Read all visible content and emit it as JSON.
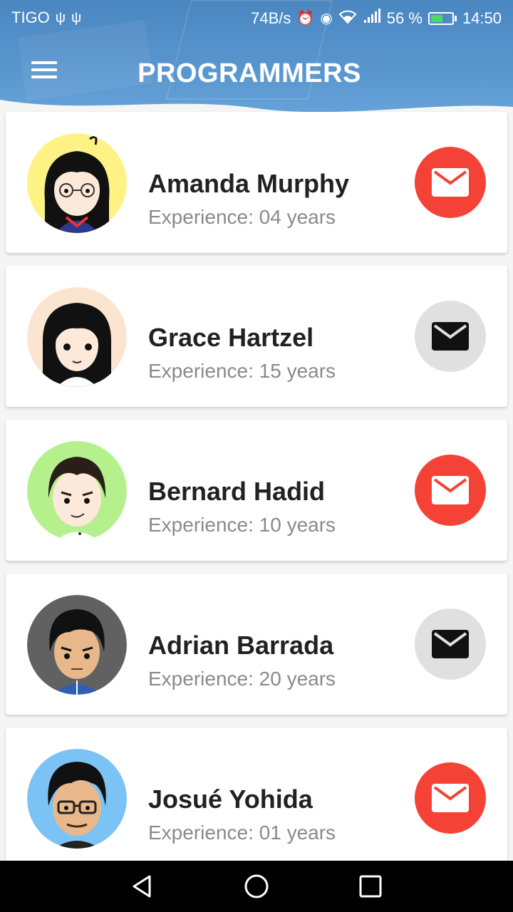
{
  "status_bar": {
    "carrier": "TIGO",
    "speed": "74B/s",
    "battery_pct": "56 %",
    "time": "14:50",
    "icons": [
      "usb-icon",
      "usb-icon",
      "alarm-icon",
      "eye-icon",
      "wifi-icon",
      "signal-icon",
      "battery-charging-icon"
    ]
  },
  "app_bar": {
    "title": "PROGRAMMERS",
    "menu_icon": "hamburger-menu-icon"
  },
  "colors": {
    "header": "#5b98d0",
    "mail_active": "#f44336",
    "mail_inactive": "#e0e0e0",
    "name_text": "#212121",
    "exp_text": "#8a8a8a"
  },
  "programmers": [
    {
      "name": "Amanda Murphy",
      "experience": "Experience: 04 years",
      "mail_state": "active",
      "avatar_bg": "#fdf384"
    },
    {
      "name": "Grace Hartzel",
      "experience": "Experience: 15 years",
      "mail_state": "inactive",
      "avatar_bg": "#fbe5d0"
    },
    {
      "name": "Bernard Hadid",
      "experience": "Experience: 10 years",
      "mail_state": "active",
      "avatar_bg": "#b4f08c"
    },
    {
      "name": "Adrian Barrada",
      "experience": "Experience: 20 years",
      "mail_state": "inactive",
      "avatar_bg": "#616161"
    },
    {
      "name": "Josué Yohida",
      "experience": "Experience: 01 years",
      "mail_state": "active",
      "avatar_bg": "#7cc3f5"
    }
  ],
  "nav_bar": {
    "buttons": [
      "back-icon",
      "home-icon",
      "recent-apps-icon"
    ]
  }
}
